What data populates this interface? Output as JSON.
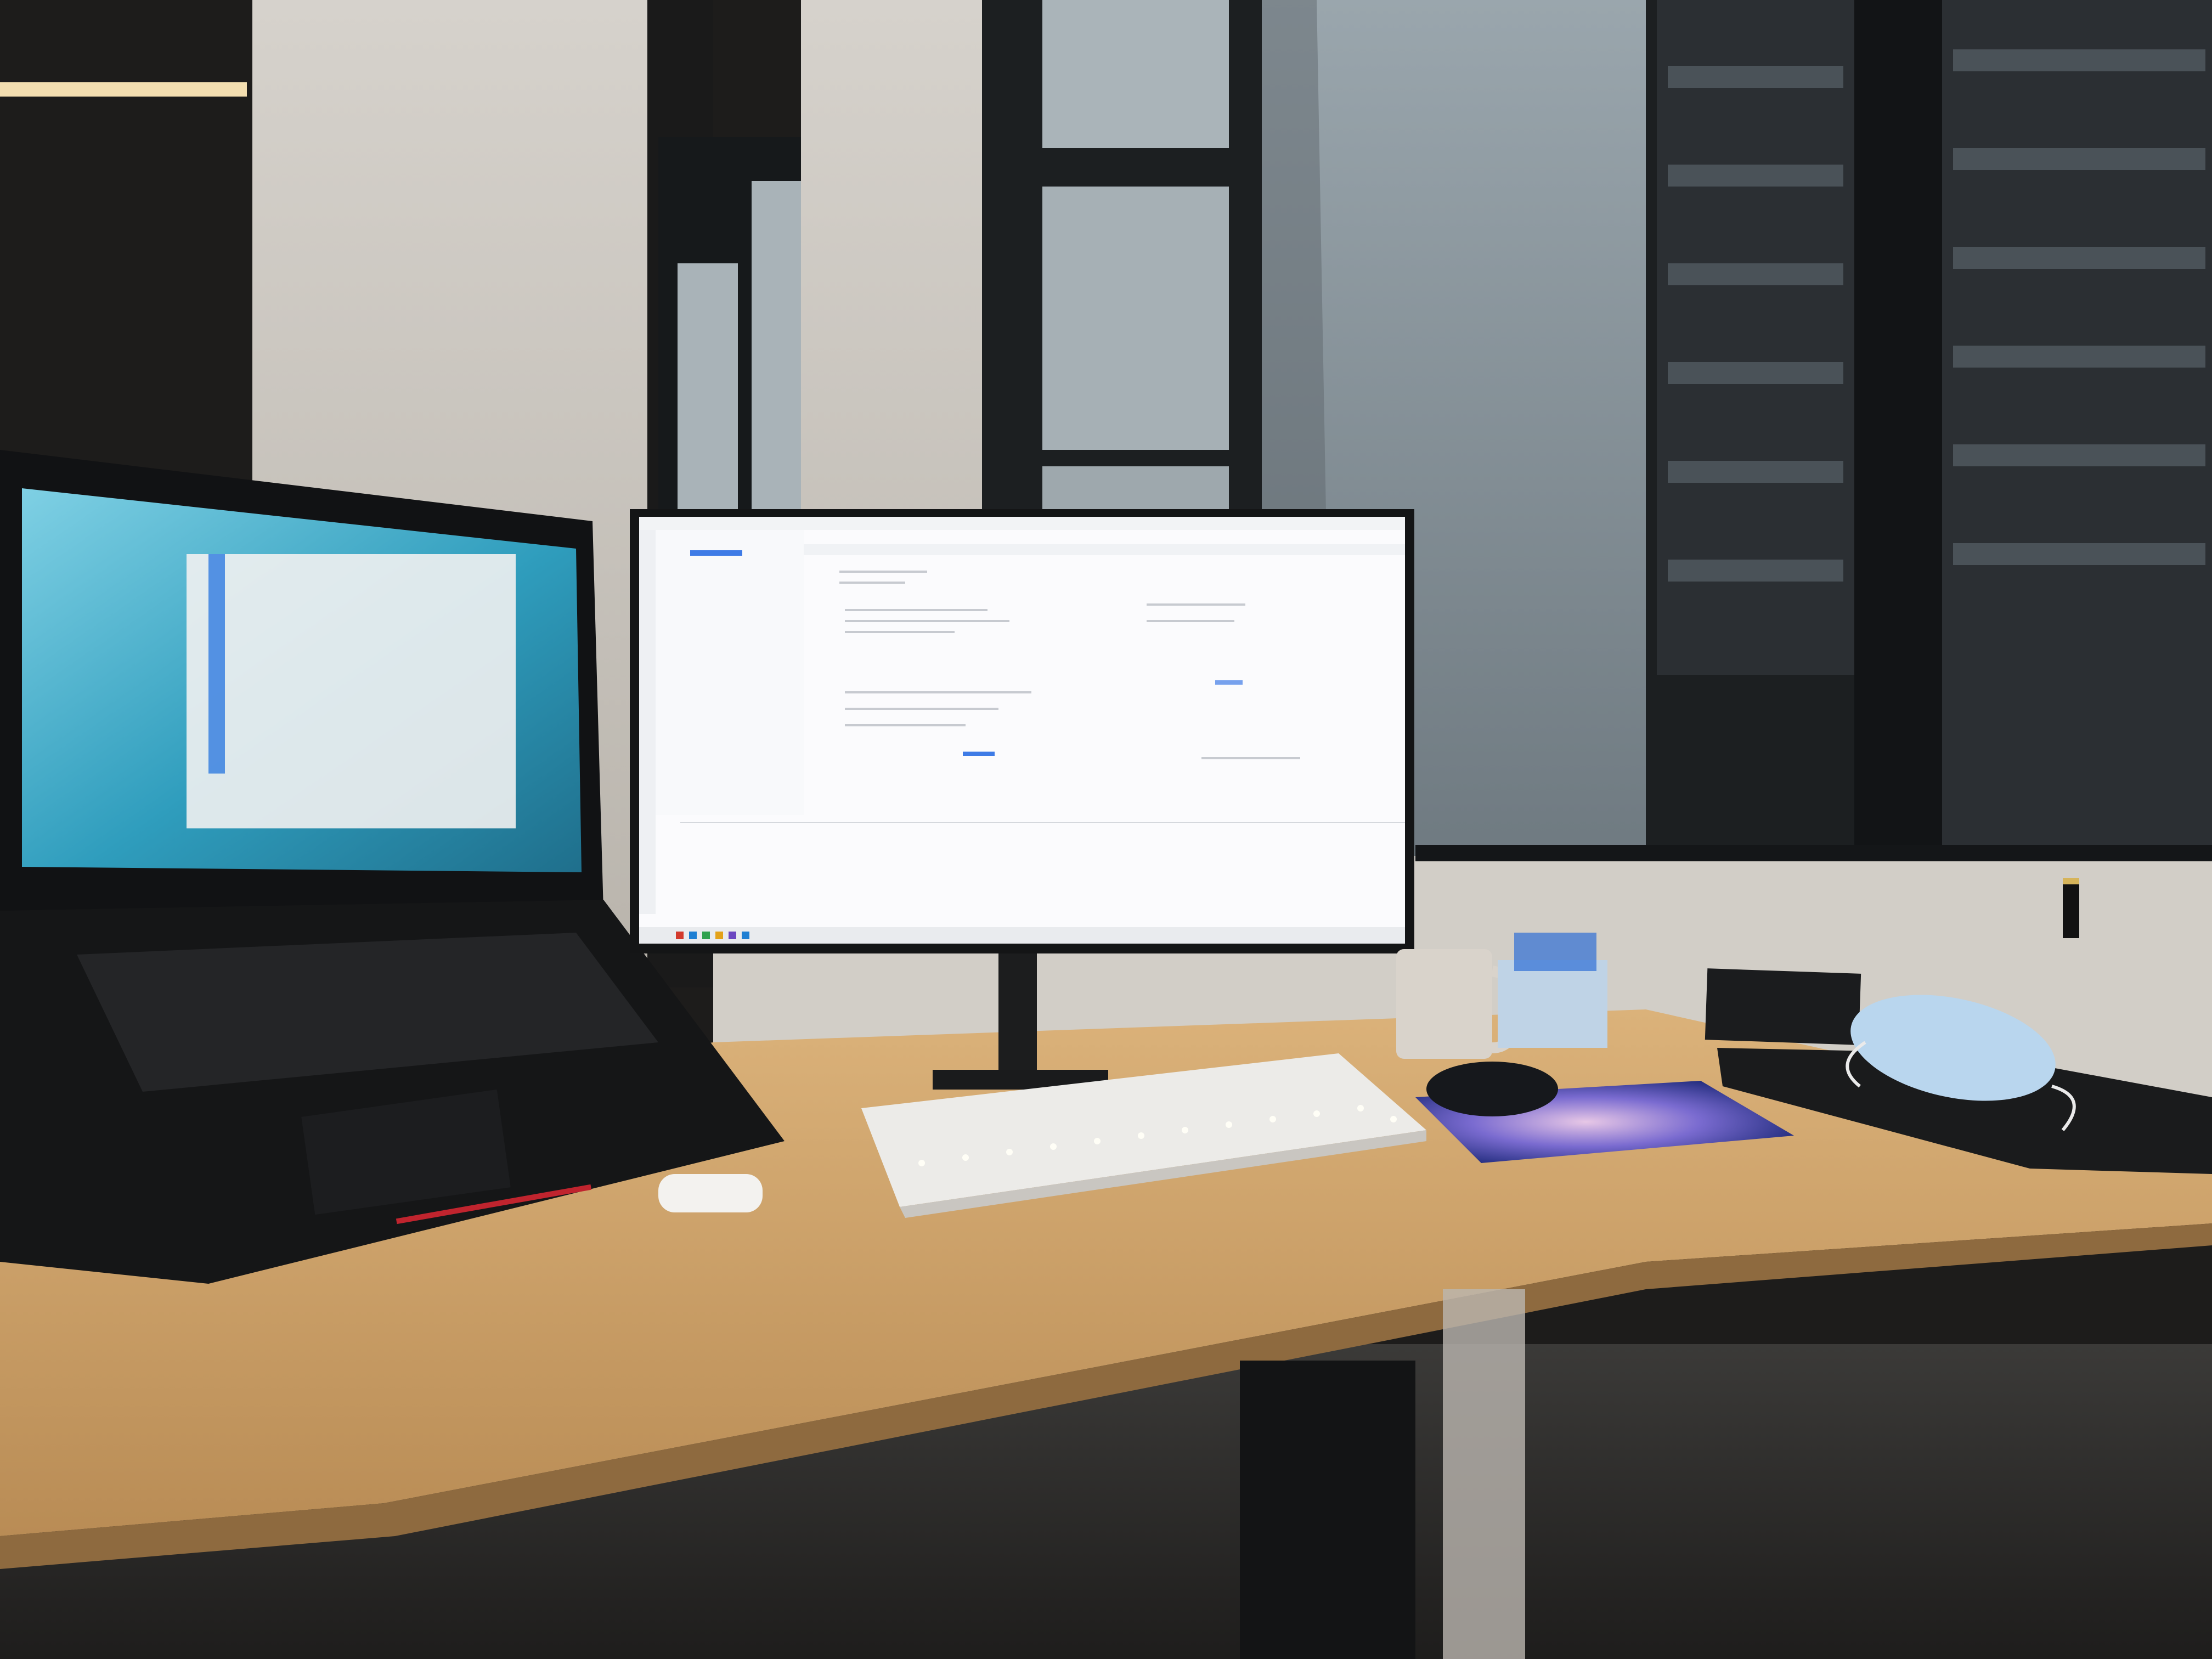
{
  "photo": {
    "ceiling_lights": [
      "#ffe9b8",
      "#fff3d6"
    ],
    "wall_color": "#c9c4bb",
    "desk_color": "#c79a63",
    "window_tint": "#8a9aa3",
    "night_building_color": "#2b2f33"
  },
  "monitor": {
    "ide_screen_color": "#fbfbfd",
    "highlight_color": "#3e7be6"
  },
  "laptop": {
    "screen_color": "#46a9c4"
  },
  "desk_items": [
    "keyboard",
    "mouse",
    "mousepad",
    "earbuds-case",
    "mug",
    "tissue-box",
    "face-mask",
    "binder"
  ]
}
